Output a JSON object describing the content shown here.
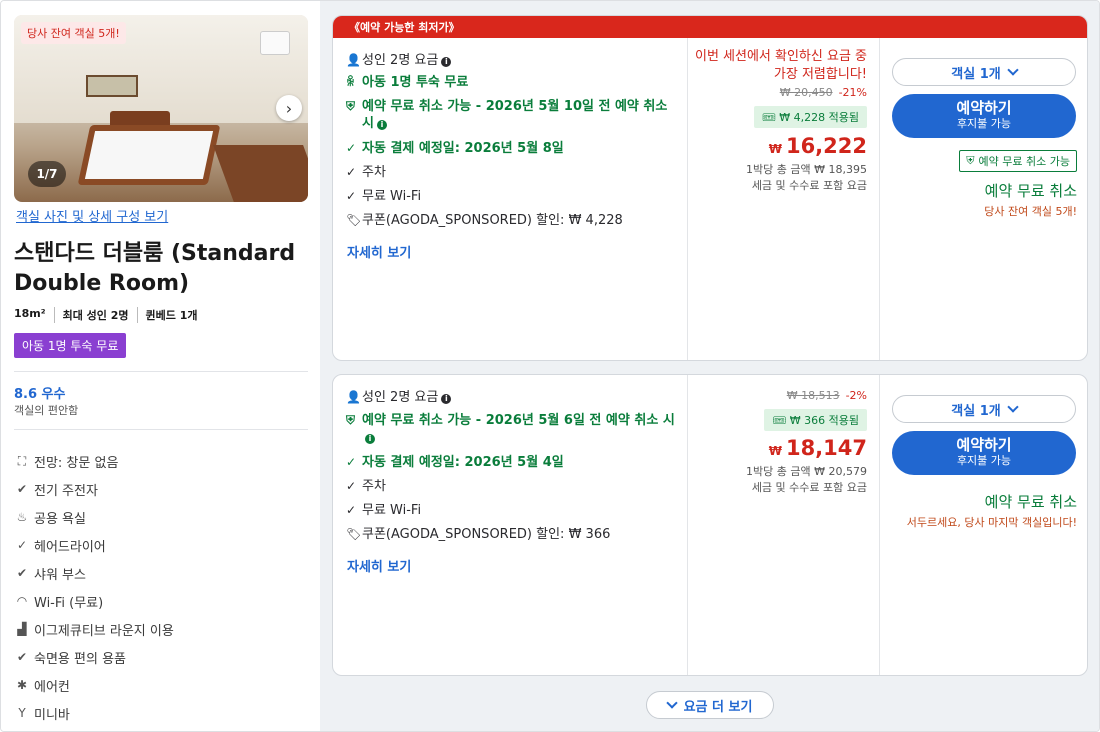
{
  "left": {
    "photo_badge": "당사 잔여 객실 5개!",
    "photo_counter": "1/7",
    "photo_link": "객실 사진 및 상세 구성 보기",
    "room_title": "스탠다드 더블룸 (Standard Double Room)",
    "meta": [
      "18m²",
      "최대 성인 2명",
      "퀸베드 1개"
    ],
    "kids_badge": "아동 1명 투숙 무료",
    "rating": "8.6 우수",
    "rating_sub": "객실의 편안함",
    "amenities": [
      {
        "icon": "view-icon",
        "label": "전망: 창문 없음"
      },
      {
        "icon": "check-circle-icon",
        "label": "전기 주전자"
      },
      {
        "icon": "bath-icon",
        "label": "공용 욕실"
      },
      {
        "icon": "check-icon",
        "label": "헤어드라이어"
      },
      {
        "icon": "check-circle-icon",
        "label": "샤워 부스"
      },
      {
        "icon": "wifi-icon",
        "label": "Wi-Fi (무료)"
      },
      {
        "icon": "lounge-icon",
        "label": "이그제큐티브 라운지 이용"
      },
      {
        "icon": "check-circle-icon",
        "label": "숙면용 편의 용품"
      },
      {
        "icon": "snowflake-icon",
        "label": "에어컨"
      },
      {
        "icon": "cocktail-icon",
        "label": "미니바"
      }
    ]
  },
  "offers": [
    {
      "header": "《예약 가능한 최저가》",
      "features": {
        "adults": "성인 2명 요금",
        "kids": "아동 1명 투숙 무료",
        "free_cancel": "예약 무료 취소 가능 - 2026년 5월 10일 전 예약 취소 시",
        "auto_pay": "자동 결제 예정일: 2026년 5월 8일",
        "parking": "주차",
        "wifi": "무료 Wi-Fi",
        "coupon": "쿠폰(AGODA_SPONSORED) 할인: ₩ 4,228"
      },
      "more_link": "자세히 보기",
      "price": {
        "note": "이번 세션에서 확인하신 요금 중 가장 저렴합니다!",
        "original": "₩ 20,450",
        "discount_pct": "-21%",
        "coupon_applied": "₩ 4,228 적용됨",
        "currency": "₩",
        "amount": "16,222",
        "total": "1박당 총 금액 ₩ 18,395",
        "tax_note": "세금 및 수수료 포함 요금"
      },
      "action": {
        "rooms": "객실 1개",
        "book": "예약하기",
        "book_sub": "후지불 가능",
        "free_badge": "예약 무료 취소 가능",
        "free_cancel": "예약 무료 취소",
        "scarcity": "당사 잔여 객실 5개!"
      }
    },
    {
      "features": {
        "adults": "성인 2명 요금",
        "free_cancel": "예약 무료 취소 가능 - 2026년 5월 6일 전 예약 취소 시",
        "auto_pay": "자동 결제 예정일: 2026년 5월 4일",
        "parking": "주차",
        "wifi": "무료 Wi-Fi",
        "coupon": "쿠폰(AGODA_SPONSORED) 할인: ₩ 366"
      },
      "more_link": "자세히 보기",
      "price": {
        "original": "₩ 18,513",
        "discount_pct": "-2%",
        "coupon_applied": "₩ 366 적용됨",
        "currency": "₩",
        "amount": "18,147",
        "total": "1박당 총 금액 ₩ 20,579",
        "tax_note": "세금 및 수수료 포함 요금"
      },
      "action": {
        "rooms": "객실 1개",
        "book": "예약하기",
        "book_sub": "후지불 가능",
        "free_cancel": "예약 무료 취소",
        "scarcity": "서두르세요, 당사 마지막 객실입니다!"
      }
    }
  ],
  "more_rates": "요금 더 보기",
  "colors": {
    "accent": "#2167d0",
    "sale_red": "#d0251b",
    "green": "#0a7d3b",
    "kids_purple": "#8a3fd1"
  }
}
